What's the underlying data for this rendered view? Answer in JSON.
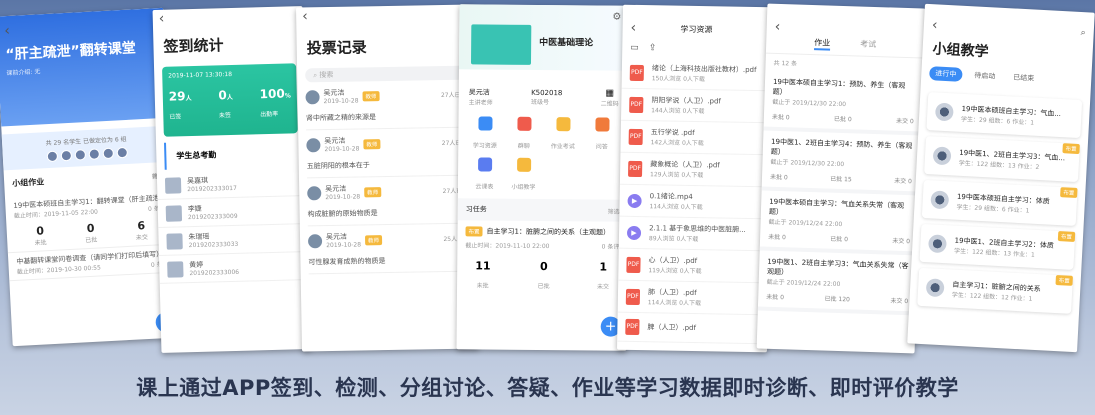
{
  "caption": "课上通过APP签到、检测、分组讨论、答疑、作业等学习数据即时诊断、即时评价教学",
  "p1": {
    "title": "“肝主疏泄”翻转课堂",
    "subtitle": "课前介绍: 无",
    "stat": "共 29 名学生  已做定位为 6 组",
    "section": "小组作业",
    "section_right": "筛选",
    "task1": "19中医本硕班自主学习1：翻转课堂（肝主疏泄）",
    "task1_time": "截止时间：2019-11-05 22:00",
    "task1_right": "0 条评",
    "n1": "0",
    "l1": "未批",
    "n2": "0",
    "l2": "已批",
    "n3": "6",
    "l3": "未交",
    "task2": "中基翻转课堂问卷调查（请同学们打印后填写）",
    "task2_time": "截止时间：2019-10-30 00:55",
    "task2_right": "0 条评"
  },
  "p2": {
    "title": "签到统计",
    "time": "2019-11-07 13:30:18",
    "n1": "29",
    "u1": "人",
    "l1": "已签",
    "n2": "0",
    "u2": "人",
    "l2": "未签",
    "n3": "100",
    "u3": "%",
    "l3": "出勤率",
    "section": "学生总考勤",
    "students": [
      {
        "name": "吴嘉琪",
        "id": "2019202333017"
      },
      {
        "name": "李婕",
        "id": "2019202333009"
      },
      {
        "name": "朱瑞瑶",
        "id": "2019202333033"
      },
      {
        "name": "黄婷",
        "id": "2019202333006"
      }
    ]
  },
  "p3": {
    "title": "投票记录",
    "search": "搜索",
    "votes": [
      {
        "name": "吴元洁",
        "date": "2019-10-28",
        "count": "27人已投",
        "q": "肾中所藏之精的来源是"
      },
      {
        "name": "吴元洁",
        "date": "2019-10-28",
        "count": "27人已投",
        "q": "五脏阴阳的根本在于"
      },
      {
        "name": "吴元洁",
        "date": "2019-10-28",
        "count": "27人已投",
        "q": "构成脏腑的原始物质是"
      },
      {
        "name": "吴元洁",
        "date": "2019-10-28",
        "count": "25人已投",
        "q": "可性腺发育成熟的物质是"
      }
    ],
    "tag": "教师"
  },
  "p4": {
    "course": "中医基础理论",
    "teacher": "吴元洁",
    "teacher_role": "主讲老师",
    "class_no": "K502018",
    "class_label": "班级号",
    "qr": "二维码",
    "grid": [
      "学习资源",
      "群聊",
      "作业考试",
      "问答",
      "云课表",
      "小组教学"
    ],
    "tasks_label": "习任务",
    "filter": "筛选",
    "task": "自主学习1：脏腑之间的关系（主观题）",
    "task_time": "截止时间：2019-11-10 22:00",
    "task_right": "0 条评",
    "n1": "11",
    "l1": "未批",
    "n2": "0",
    "l2": "已批",
    "n3": "1",
    "l3": "未交",
    "tag": "布置"
  },
  "p5": {
    "title": "学习资源",
    "items": [
      {
        "name": "绪论（上海科技出版社教材）.pdf",
        "meta": "150人浏览  0人下载",
        "kind": "pdf"
      },
      {
        "name": "阴阳学说（人卫）.pdf",
        "meta": "144人浏览  0人下载",
        "kind": "pdf"
      },
      {
        "name": "五行学说 .pdf",
        "meta": "142人浏览  0人下载",
        "kind": "pdf"
      },
      {
        "name": "藏象概论（人卫）.pdf",
        "meta": "129人浏览  0人下载",
        "kind": "pdf"
      },
      {
        "name": "0.1绪论.mp4",
        "meta": "114人浏览  0人下载",
        "kind": "video"
      },
      {
        "name": "2.1.1 基于象思维的中医脏腑...",
        "meta": "89人浏览  0人下载",
        "kind": "video"
      },
      {
        "name": "心（人卫）.pdf",
        "meta": "119人浏览  0人下载",
        "kind": "pdf"
      },
      {
        "name": "肺（人卫）.pdf",
        "meta": "114人浏览  0人下载",
        "kind": "pdf"
      },
      {
        "name": "脾（人卫）.pdf",
        "meta": "",
        "kind": "pdf"
      }
    ]
  },
  "p6": {
    "tab1": "作业",
    "tab2": "考试",
    "count": "共 12 条",
    "items": [
      {
        "t": "19中医本硕自主学习1：预防、养生（客观题）",
        "time": "截止于 2019/12/30 22:00",
        "a": "0",
        "b": "0",
        "c": "0"
      },
      {
        "t": "19中医1、2班自主学习4：预防、养生（客观题）",
        "time": "截止于 2019/12/30 22:00",
        "a": "0",
        "b": "15",
        "c": "0"
      },
      {
        "t": "19中医本硕自主学习：气血关系失常（客观题）",
        "time": "截止于 2019/12/24 22:00",
        "a": "0",
        "b": "0",
        "c": "0"
      },
      {
        "t": "19中医1、2班自主学习3：气血关系失常（客观题）",
        "time": "截止于 2019/12/24 22:00",
        "a": "0",
        "b": "120",
        "c": "0"
      }
    ],
    "la": "未批",
    "lb": "已批",
    "lc": "未交"
  },
  "p7": {
    "title": "小组教学",
    "chips": [
      "进行中",
      "待启动",
      "已结束"
    ],
    "groups": [
      {
        "t": "19中医本硕班自主学习：气血...",
        "meta": "学生：29    组数：6   作业：1",
        "tag": ""
      },
      {
        "t": "19中医1、2班自主学习3：气血...",
        "meta": "学生：122    组数：13   作业：2",
        "tag": "布置"
      },
      {
        "t": "19中医本硕班自主学习：体质",
        "meta": "学生：29    组数：6   作业：1",
        "tag": "布置"
      },
      {
        "t": "19中医1、2班自主学习2：体质",
        "meta": "学生：122    组数：13   作业：1",
        "tag": "布置"
      },
      {
        "t": "自主学习1：脏腑之间的关系",
        "meta": "学生：122    组数：12   作业：1",
        "tag": "布置"
      }
    ]
  }
}
